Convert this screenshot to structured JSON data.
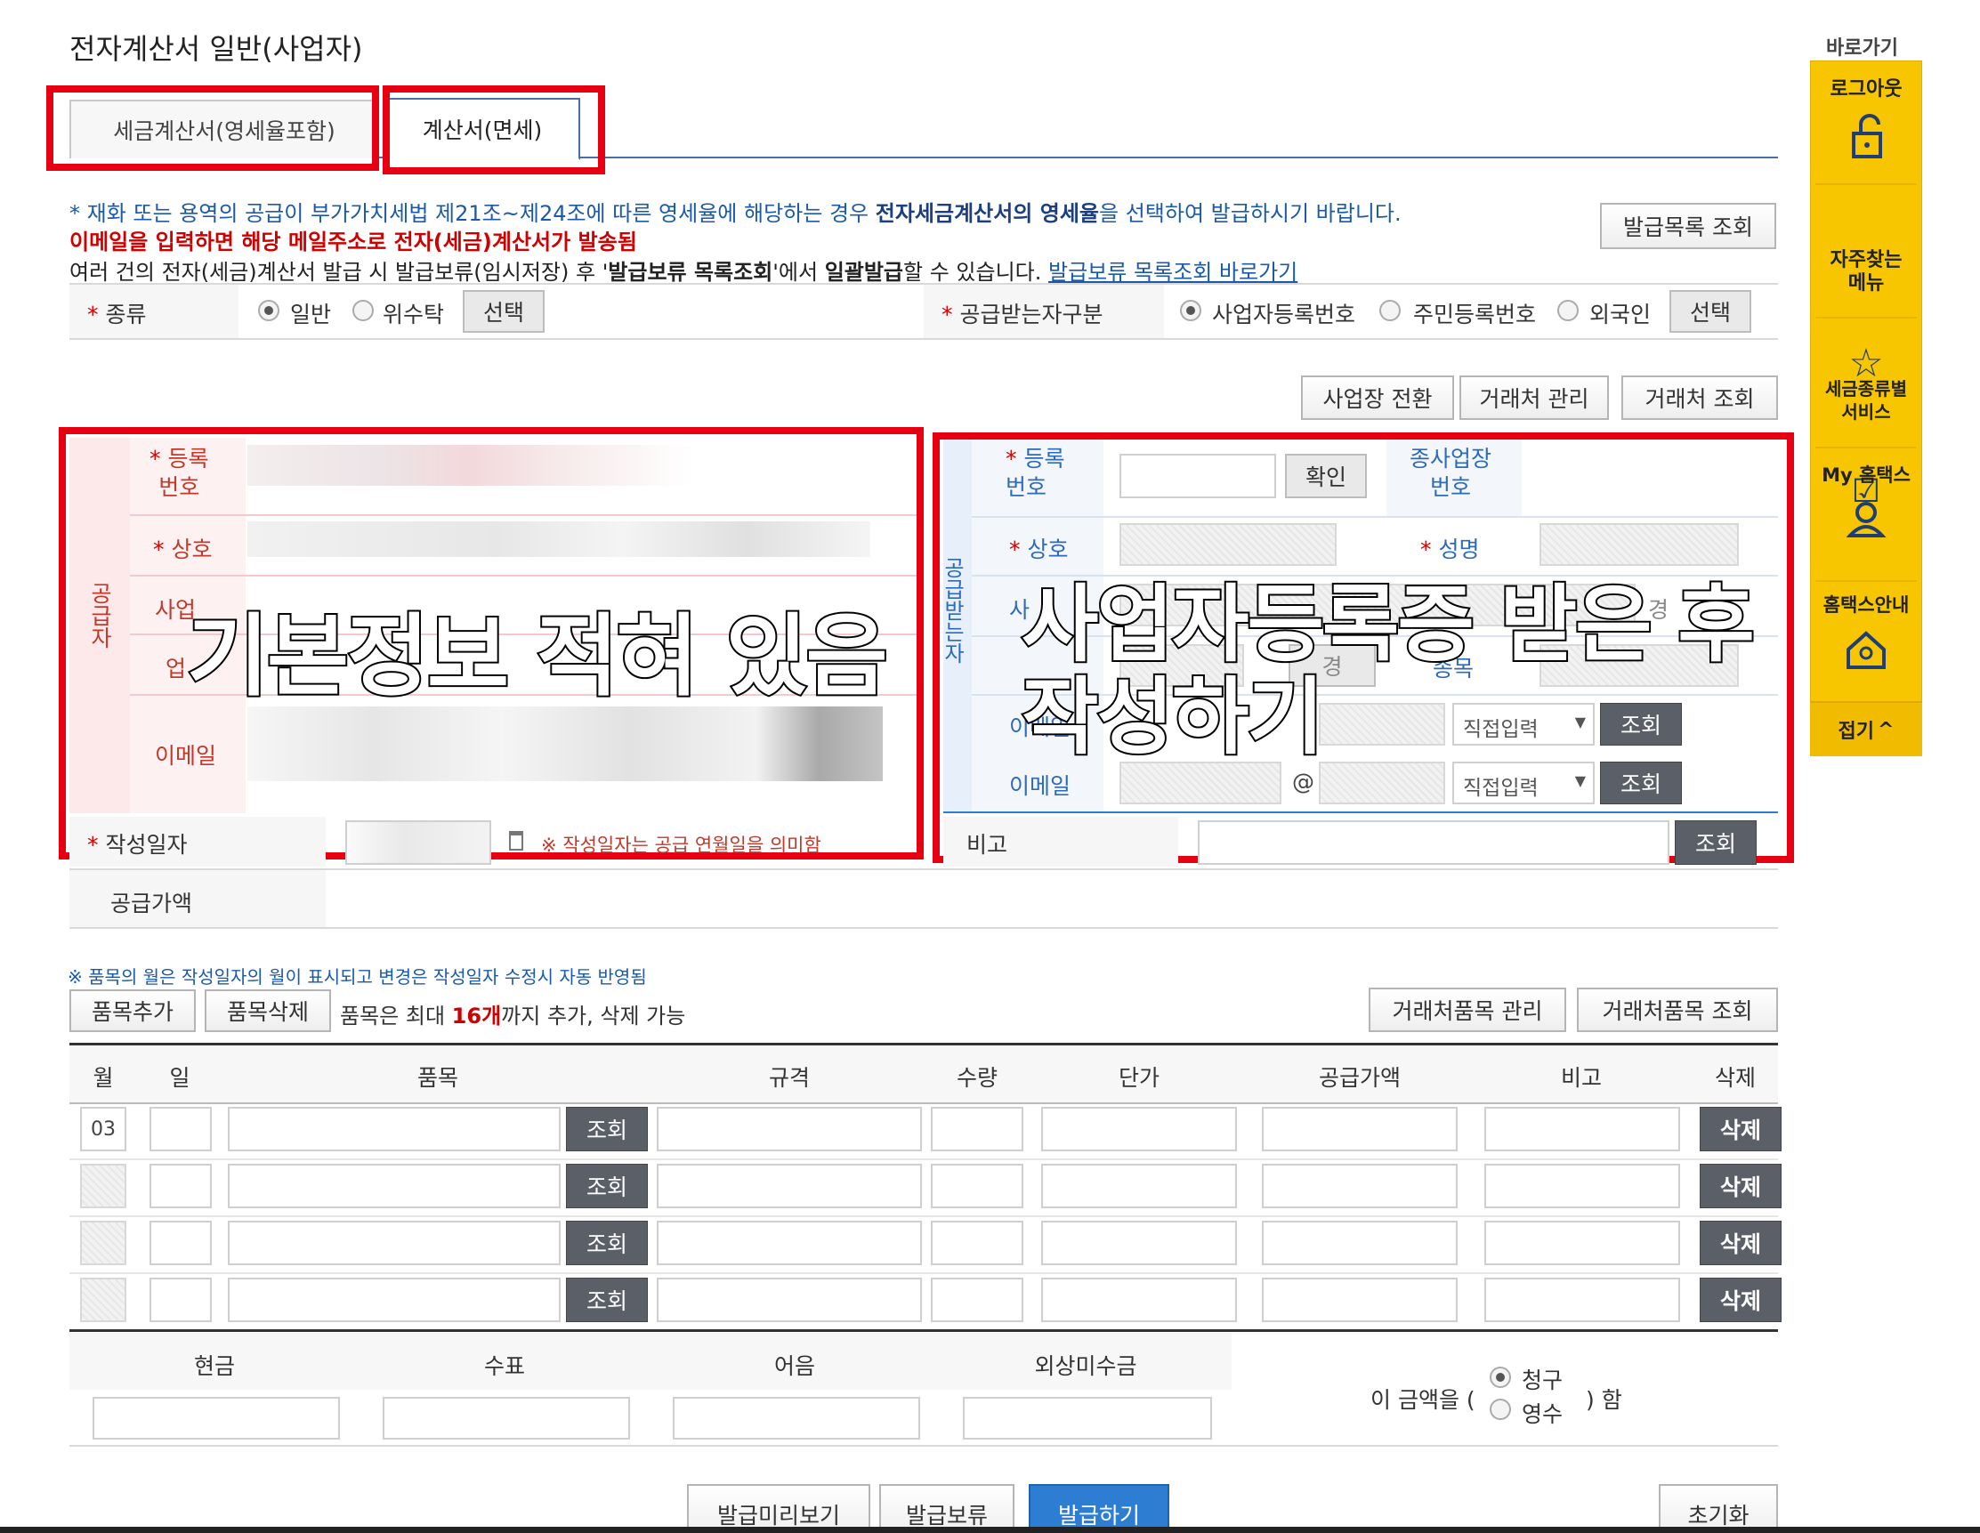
{
  "page_title": "전자계산서 일반(사업자)",
  "tabs": [
    {
      "label": "세금계산서(영세율포함)",
      "active": false
    },
    {
      "label": "계산서(면세)",
      "active": true
    }
  ],
  "notices": {
    "line1_a": "* 재화 또는 용역의 공급이 부가가치세법 제21조~제24조에 따른 영세율에 해당하는 경우 ",
    "line1_b": "전자세금계산서의 영세율",
    "line1_c": "을 선택하여 발급하시기 바랍니다.",
    "line2": "이메일을 입력하면 해당 메일주소로 전자(세금)계산서가 발송됨",
    "line3_a": "여러 건의 전자(세금)계산서 발급 시 발급보류(임시저장) 후 '",
    "line3_b": "발급보류 목록조회",
    "line3_c": "'에서 ",
    "line3_d": "일괄발급",
    "line3_e": "할 수 있습니다. ",
    "line3_link": "발급보류 목록조회 바로가기"
  },
  "issue_list_button": "발급목록 조회",
  "kind": {
    "label": "종류",
    "options": [
      "일반",
      "위수탁"
    ],
    "selected": "일반",
    "select_button": "선택"
  },
  "receiver_type": {
    "label": "공급받는자구분",
    "options": [
      "사업자등록번호",
      "주민등록번호",
      "외국인"
    ],
    "selected": "사업자등록번호",
    "select_button": "선택"
  },
  "top_buttons": [
    "사업장 전환",
    "거래처 관리",
    "거래처 조회"
  ],
  "supplier": {
    "side_label": "공급자",
    "fields": {
      "reg_no": "등록\n번호",
      "name": "상호",
      "address": "사업",
      "business": "업",
      "email": "이메일"
    }
  },
  "receiver": {
    "side_label": "공급받는자",
    "reg_no": "등록\n번호",
    "confirm_button": "확인",
    "sub_biz_no": "종사업장\n번호",
    "name": "상호",
    "ceo": "성명",
    "address": "사",
    "change_suffix": "경",
    "item_label": "종목",
    "email_label_1": "이메일",
    "email_label_2": "이메일",
    "at": "@",
    "direct_input": "직접입력",
    "lookup_button": "조회"
  },
  "write_date": {
    "label": "작성일자",
    "note": "※ 작성일자는 공급 연월일을 의미함"
  },
  "remarks": {
    "label": "비고",
    "button": "조회"
  },
  "supply_amount_label": "공급가액",
  "item_note": "※ 품목의 월은 작성일자의 월이 표시되고 변경은 작성일자 수정시 자동 반영됨",
  "item_buttons": {
    "add": "품목추가",
    "delete": "품목삭제"
  },
  "item_limit": {
    "prefix": "품목은 최대 ",
    "count": "16개",
    "suffix": "까지 추가, 삭제 가능"
  },
  "item_manage_buttons": [
    "거래처품목 관리",
    "거래처품목 조회"
  ],
  "table": {
    "headers": [
      "월",
      "일",
      "품목",
      "규격",
      "수량",
      "단가",
      "공급가액",
      "비고",
      "삭제"
    ],
    "first_month": "03",
    "lookup_button": "조회",
    "delete_button": "삭제",
    "row_count": 4
  },
  "payment": {
    "headers": [
      "현금",
      "수표",
      "어음",
      "외상미수금"
    ],
    "amount_prefix": "이 금액을 (",
    "amount_suffix": ") 함",
    "options": [
      "청구",
      "영수"
    ],
    "selected": "청구"
  },
  "bottom_buttons": [
    "발급미리보기",
    "발급보류",
    "발급하기"
  ],
  "reset_button": "초기화",
  "sidebar": {
    "title": "바로가기",
    "items": [
      "로그아웃",
      "자주찾는\n메뉴",
      "세금종류별\n서비스",
      "My 홈택스",
      "홈택스안내"
    ],
    "collapse": "접기"
  },
  "annotations": {
    "left": "기본정보 적혀 있음",
    "right_line1": "사업자등록증 받은 후",
    "right_line2": "작성하기"
  },
  "colors": {
    "accent_red": "#e60012",
    "primary_blue": "#2d7dd2",
    "sidebar_yellow": "#f7c600",
    "supplier_pink": "#fde8ea",
    "receiver_blue": "#e6effa"
  }
}
